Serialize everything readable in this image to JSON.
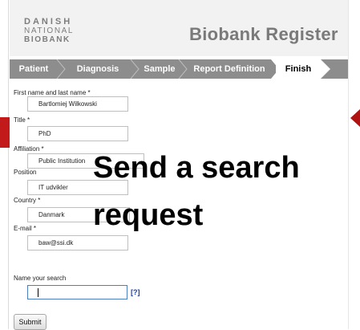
{
  "logo": {
    "line1": "DANISH",
    "line2": "NATIONAL",
    "line3": "BIOBANK"
  },
  "app_title": "Biobank Register",
  "steps": [
    {
      "label": "Patient"
    },
    {
      "label": "Diagnosis"
    },
    {
      "label": "Sample"
    },
    {
      "label": "Report Definition"
    },
    {
      "label": "Finish",
      "active": true
    }
  ],
  "form": {
    "name": {
      "label": "First name and last name *",
      "value": "Bartlomiej Wilkowski"
    },
    "title": {
      "label": "Title *",
      "value": "PhD"
    },
    "affiliation": {
      "label": "Affiliation *",
      "value": "Public Institution"
    },
    "position": {
      "label": "Position",
      "value": "IT udvikler"
    },
    "country": {
      "label": "Country *",
      "value": "Danmark"
    },
    "email": {
      "label": "E-mail *",
      "value": "baw@ssi.dk"
    },
    "search_name": {
      "label": "Name your search",
      "value": ""
    },
    "help": "[?]",
    "submit": "Submit"
  },
  "overlay": {
    "line1": "Send a search",
    "line2": "request"
  },
  "colors": {
    "accent_red": "#c21a1a",
    "steps_bar": "#8d8d8d",
    "help_link": "#1c3fa8"
  }
}
